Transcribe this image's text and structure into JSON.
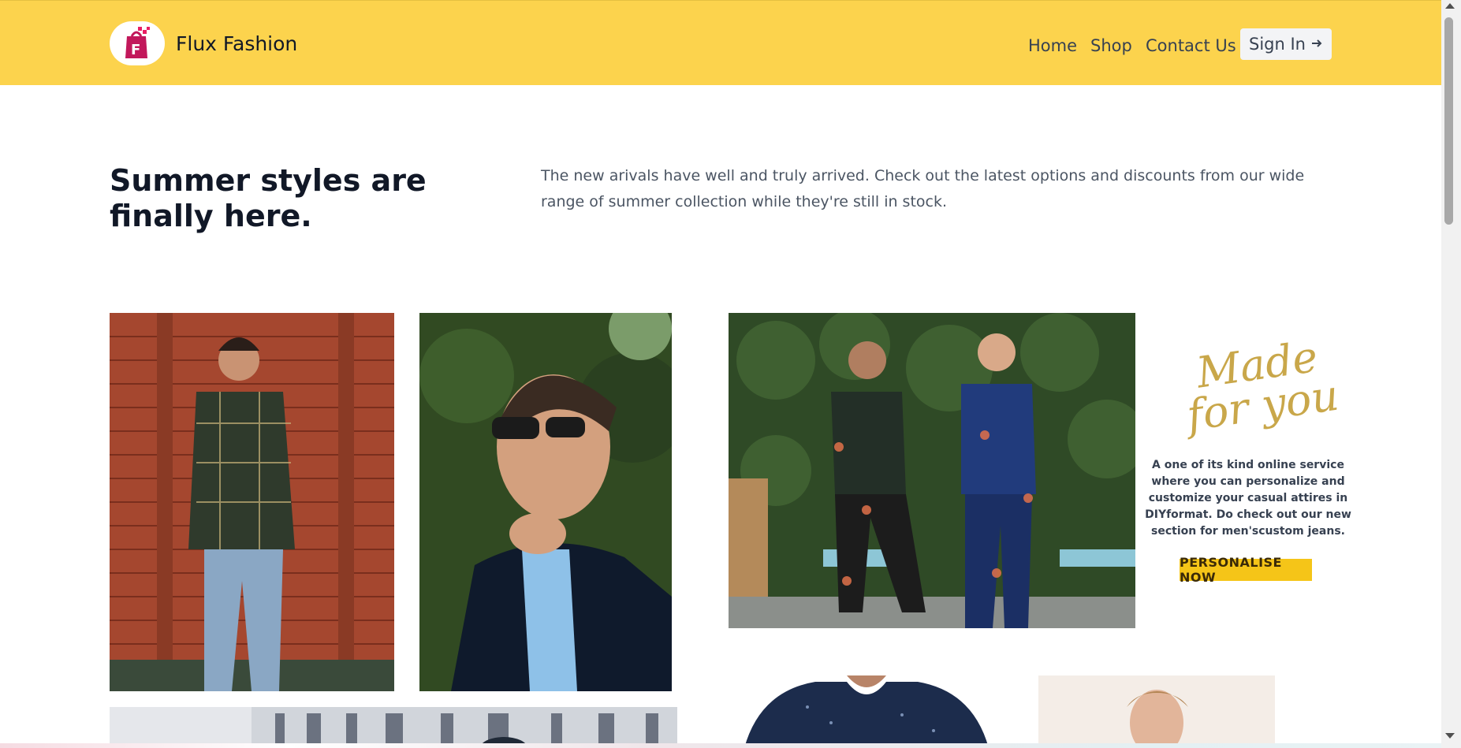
{
  "header": {
    "brand_name": "Flux Fashion",
    "logo_letter": "F",
    "nav": [
      {
        "label": "Home"
      },
      {
        "label": "Shop"
      },
      {
        "label": "Contact Us"
      }
    ],
    "signin_label": "Sign In",
    "signin_icon": "arrow-right-icon"
  },
  "hero": {
    "headline": "Summer styles are finally here.",
    "lead": "The new arivals have well and truly arrived. Check out the latest options and discounts from our wide range of summer collection while they're still in stock."
  },
  "promo": {
    "script_line1": "Made",
    "script_line2": "for you",
    "text": "A one of its kind online service where you can personalize and customize your casual attires in DIYformat. Do check out our new section for men'scustom jeans.",
    "button": "PERSONALISE NOW"
  },
  "colors": {
    "header_bg": "#fcd34d",
    "promo_button": "#f5c518",
    "logo_bag": "#c2185b"
  }
}
